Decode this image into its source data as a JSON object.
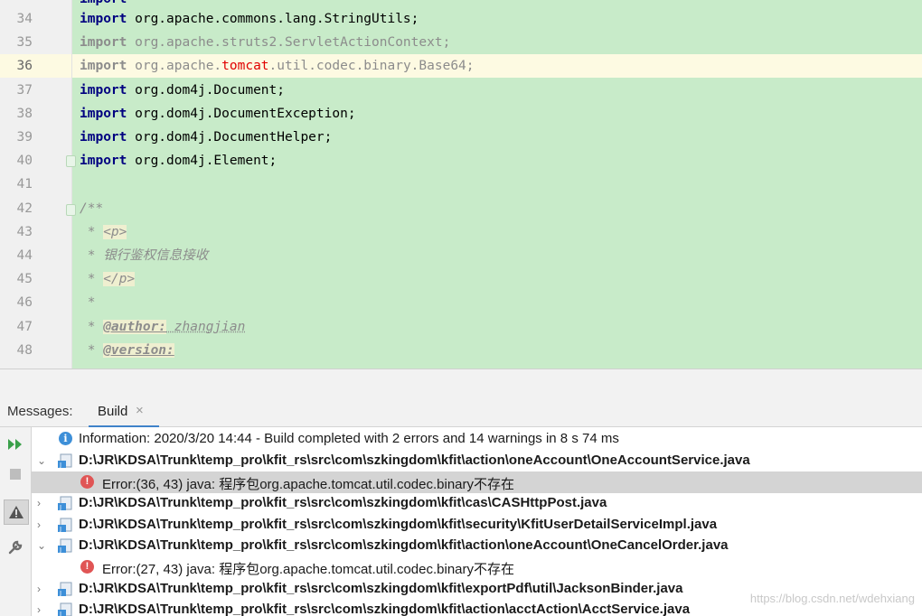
{
  "editor": {
    "lines": [
      {
        "num": "34",
        "kw": "import",
        "text": " org.apache.commons.lang.StringUtils;",
        "dim": false
      },
      {
        "num": "35",
        "kw": "import",
        "text": " org.apache.struts2.ServletActionContext;",
        "dim": true
      },
      {
        "num": "36",
        "kw": "import",
        "pre": " org.apache.",
        "red": "tomcat",
        "post": ".util.codec.binary.Base64;",
        "dim": true,
        "current": true
      },
      {
        "num": "37",
        "kw": "import",
        "text": " org.dom4j.Document;",
        "dim": false
      },
      {
        "num": "38",
        "kw": "import",
        "text": " org.dom4j.DocumentException;",
        "dim": false
      },
      {
        "num": "39",
        "kw": "import",
        "text": " org.dom4j.DocumentHelper;",
        "dim": false
      },
      {
        "num": "40",
        "kw": "import",
        "text": " org.dom4j.Element;",
        "dim": false
      },
      {
        "num": "41"
      },
      {
        "num": "42",
        "doc": "/**"
      },
      {
        "num": "43",
        "doc": " * ",
        "tag": "<p>"
      },
      {
        "num": "44",
        "doc": " * 银行鉴权信息接收"
      },
      {
        "num": "45",
        "doc": " * ",
        "tag": "</p>"
      },
      {
        "num": "46",
        "doc": " *"
      },
      {
        "num": "47",
        "doc": " * ",
        "doctag": "@author:",
        "docval": " zhangjian"
      },
      {
        "num": "48",
        "doc": " * ",
        "doctag": "@version:"
      }
    ]
  },
  "messages": {
    "label": "Messages:",
    "tab_label": "Build",
    "tab_close": "×"
  },
  "toolbar": {
    "icons": [
      "rerun-icon",
      "stop-icon",
      "warning-filter-icon",
      "settings-wrench-icon"
    ]
  },
  "tree": {
    "info": "Information: 2020/3/20 14:44 - Build completed with 2 errors and 14 warnings in 8 s 74 ms",
    "rows": [
      {
        "type": "file",
        "expanded": true,
        "path": "D:\\JR\\KDSA\\Trunk\\temp_pro\\kfit_rs\\src\\com\\szkingdom\\kfit\\action\\oneAccount\\OneAccountService.java"
      },
      {
        "type": "error",
        "text": "Error:(36, 43)  java: 程序包org.apache.tomcat.util.codec.binary不存在",
        "selected": true
      },
      {
        "type": "file",
        "expanded": false,
        "path": "D:\\JR\\KDSA\\Trunk\\temp_pro\\kfit_rs\\src\\com\\szkingdom\\kfit\\cas\\CASHttpPost.java"
      },
      {
        "type": "file",
        "expanded": false,
        "path": "D:\\JR\\KDSA\\Trunk\\temp_pro\\kfit_rs\\src\\com\\szkingdom\\kfit\\security\\KfitUserDetailServiceImpl.java"
      },
      {
        "type": "file",
        "expanded": true,
        "path": "D:\\JR\\KDSA\\Trunk\\temp_pro\\kfit_rs\\src\\com\\szkingdom\\kfit\\action\\oneAccount\\OneCancelOrder.java"
      },
      {
        "type": "error",
        "text": "Error:(27, 43)  java: 程序包org.apache.tomcat.util.codec.binary不存在",
        "selected": false
      },
      {
        "type": "file",
        "expanded": false,
        "path": "D:\\JR\\KDSA\\Trunk\\temp_pro\\kfit_rs\\src\\com\\szkingdom\\kfit\\exportPdf\\util\\JacksonBinder.java"
      },
      {
        "type": "file",
        "expanded": false,
        "path": "D:\\JR\\KDSA\\Trunk\\temp_pro\\kfit_rs\\src\\com\\szkingdom\\kfit\\action\\acctAction\\AcctService.java"
      }
    ]
  },
  "watermark": "https://blog.csdn.net/wdehxiang",
  "colors": {
    "editor_bg": "#c8ebc9",
    "current_line": "#fdfae2",
    "keyword": "#000080",
    "error_red": "#e05555",
    "info_blue": "#3d8fd8",
    "tab_underline": "#4083c9"
  }
}
